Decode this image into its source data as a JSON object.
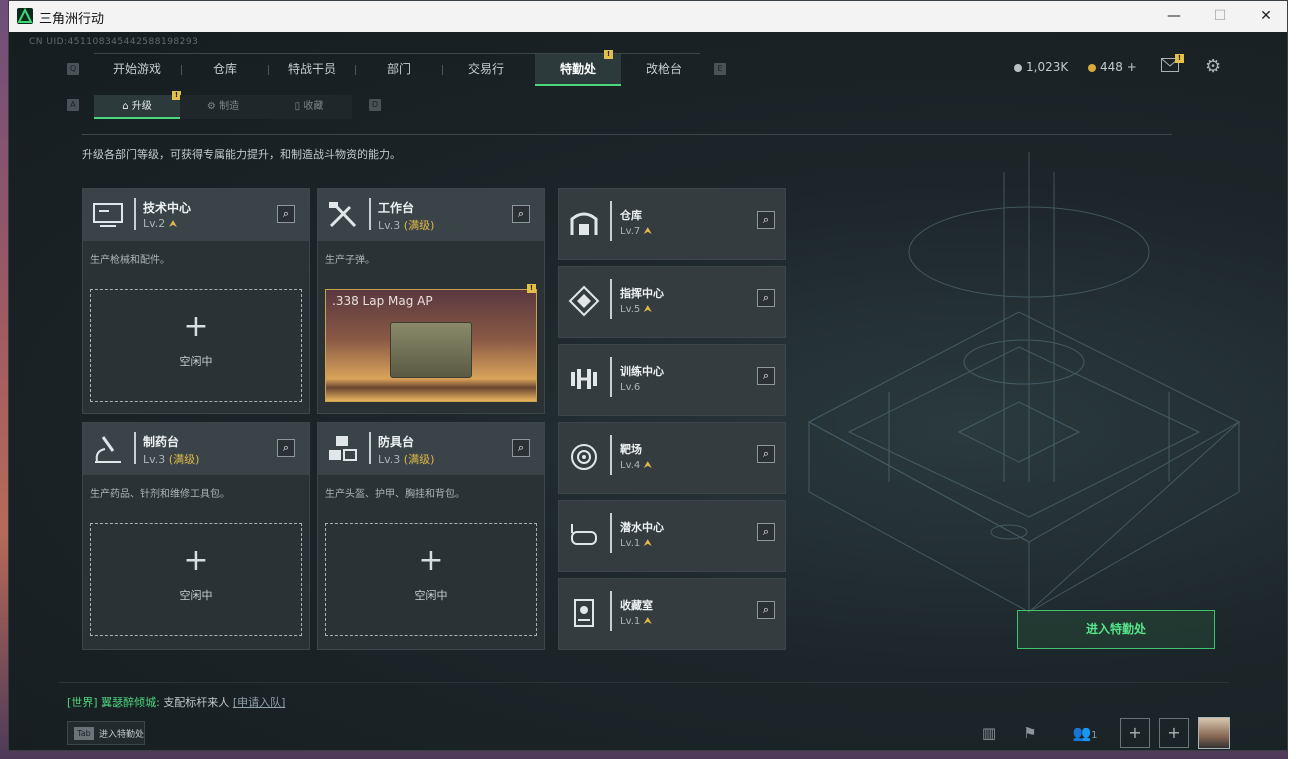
{
  "window": {
    "title": "三角洲行动",
    "minimize": "—",
    "maximize": "☐",
    "close": "✕"
  },
  "uid": "CN UID:451108345442588198293",
  "nav": {
    "left_key": "Q",
    "right_key": "E",
    "items": [
      "开始游戏",
      "仓库",
      "特战干员",
      "部门",
      "交易行",
      "特勤处",
      "改枪台"
    ],
    "active": "特勤处"
  },
  "currency": {
    "silver": "1,023K",
    "gold": "448 +",
    "silver_color": "#b9c0c4",
    "gold_color": "#d9a93a"
  },
  "subtabs": {
    "left_key": "A",
    "right_key": "D",
    "items": [
      "升级",
      "制造",
      "收藏"
    ],
    "active": "升级"
  },
  "description": "升级各部门等级，可获得专属能力提升，和制造战斗物资的能力。",
  "cards": [
    {
      "name": "技术中心",
      "level": "Lv.2",
      "desc": "生产枪械和配件。",
      "slot": "空闲中"
    },
    {
      "name": "工作台",
      "level": "Lv.3",
      "max": "(满级)",
      "desc": "生产子弹。",
      "product": ".338 Lap Mag AP"
    },
    {
      "name": "制药台",
      "level": "Lv.3",
      "max": "(满级)",
      "desc": "生产药品、针剂和维修工具包。",
      "slot": "空闲中"
    },
    {
      "name": "防具台",
      "level": "Lv.3",
      "max": "(满级)",
      "desc": "生产头盔、护甲、胸挂和背包。",
      "slot": "空闲中"
    }
  ],
  "facilities": [
    {
      "name": "仓库",
      "level": "Lv.7",
      "icon": "storage-icon"
    },
    {
      "name": "指挥中心",
      "level": "Lv.5",
      "icon": "command-icon"
    },
    {
      "name": "训练中心",
      "level": "Lv.6",
      "icon": "dumbbell-icon"
    },
    {
      "name": "靶场",
      "level": "Lv.4",
      "icon": "target-icon"
    },
    {
      "name": "潜水中心",
      "level": "Lv.1",
      "icon": "diving-mask-icon"
    },
    {
      "name": "收藏室",
      "level": "Lv.1",
      "icon": "collection-icon"
    }
  ],
  "enter_button": "进入特勤处",
  "chat": {
    "channel": "[世界]",
    "user": "翼瑟醉倾城:",
    "message": "支配标杆来人",
    "link": "[申请入队]"
  },
  "tab_hint": {
    "key": "Tab",
    "label": "进入特勤处"
  },
  "bottom": {
    "friends_count": "1",
    "plus": "+"
  },
  "accent": "#4ed67f",
  "badge_mark": "!"
}
